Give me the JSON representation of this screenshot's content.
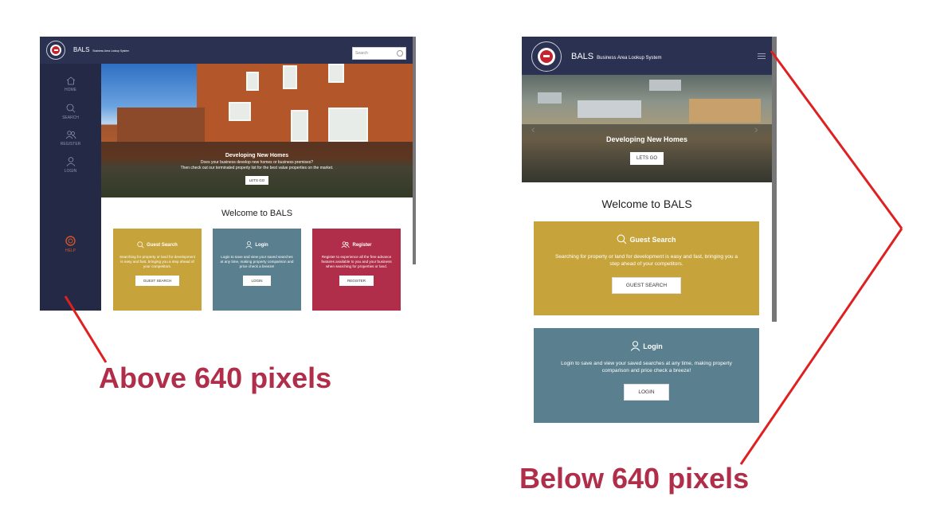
{
  "desktop": {
    "brand_name": "BALS",
    "brand_sub": "Business Area Lookup System",
    "search_placeholder": "Search",
    "nav": [
      {
        "label": "HOME",
        "icon": "home-icon"
      },
      {
        "label": "SEARCH",
        "icon": "search-icon"
      },
      {
        "label": "REGISTER",
        "icon": "users-icon"
      },
      {
        "label": "LOGIN",
        "icon": "user-icon"
      }
    ],
    "help_label": "HELP",
    "hero": {
      "title": "Developing New Homes",
      "line1": "Does your business develop new homes or business premises?",
      "line2": "Then check out our terminated property list for the best value properties on the market.",
      "button": "LETS GO"
    },
    "welcome": "Welcome to BALS",
    "cards": [
      {
        "title": "Guest Search",
        "body": "Searching for property or land for development is easy and fast, bringing you a step ahead of your competitors.",
        "button": "GUEST SEARCH"
      },
      {
        "title": "Login",
        "body": "Login to save and view your saved searches at any time, making property comparison and price check a breeze!",
        "button": "LOGIN"
      },
      {
        "title": "Register",
        "body": "Register to experience all the free advance features available to you and your business when searching for properties or land.",
        "button": "REGISTER"
      }
    ]
  },
  "mobile": {
    "brand_name": "BALS",
    "brand_sub": "Business Area Lookup System",
    "hero": {
      "title": "Developing New Homes",
      "button": "LETS GO"
    },
    "welcome": "Welcome to BALS",
    "cards": [
      {
        "title": "Guest Search",
        "body": "Searching for property or land for development is easy and fast, bringing you a step ahead of your competitors.",
        "button": "GUEST SEARCH"
      },
      {
        "title": "Login",
        "body": "Login to save and view your saved searches at any time, making property comparison and price check a breeze!",
        "button": "LOGIN"
      }
    ]
  },
  "annotations": {
    "above": "Above 640 pixels",
    "below": "Below 640 pixels"
  },
  "colors": {
    "navy": "#2b3150",
    "sidebar": "#242a45",
    "gold": "#c6a43b",
    "teal": "#5a7f8e",
    "crimson": "#b02e49",
    "annotation": "#b02e49",
    "arrow": "#e02020"
  }
}
